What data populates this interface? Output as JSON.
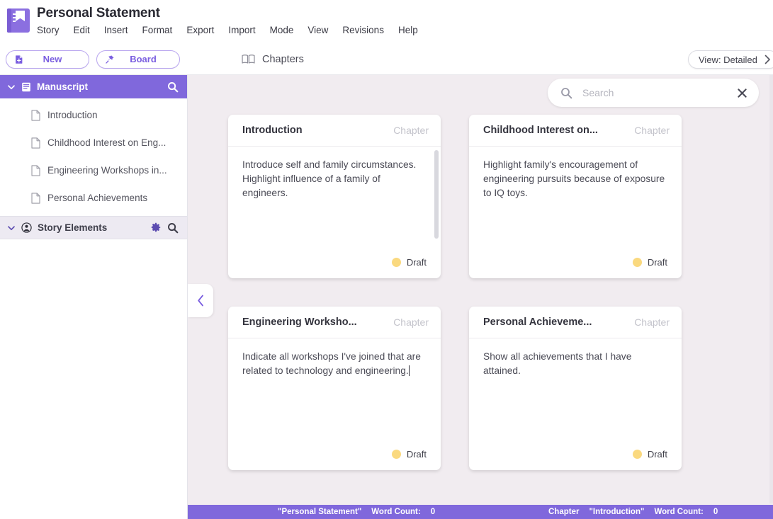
{
  "app": {
    "title": "Personal Statement",
    "logo_icon": "book-journal-icon"
  },
  "menubar": {
    "items": [
      {
        "label": "Story"
      },
      {
        "label": "Edit"
      },
      {
        "label": "Insert"
      },
      {
        "label": "Format"
      },
      {
        "label": "Export"
      },
      {
        "label": "Import"
      },
      {
        "label": "Mode"
      },
      {
        "label": "View"
      },
      {
        "label": "Revisions"
      },
      {
        "label": "Help"
      }
    ]
  },
  "toolbar": {
    "new_label": "New",
    "new_icon": "new-document-icon",
    "board_label": "Board",
    "board_icon": "pin-icon"
  },
  "content_header": {
    "title": "Chapters",
    "icon": "open-book-icon",
    "view_toggle_label": "View: Detailed",
    "view_toggle_icon": "chevron-right-icon"
  },
  "sidebar": {
    "manuscript": {
      "label": "Manuscript",
      "collapse_icon": "chevron-down-icon",
      "section_icon": "manuscript-icon",
      "search_icon": "search-icon",
      "documents": [
        {
          "label": "Introduction",
          "icon": "document-icon"
        },
        {
          "label": "Childhood Interest on Eng...",
          "icon": "document-icon"
        },
        {
          "label": "Engineering Workshops in...",
          "icon": "document-icon"
        },
        {
          "label": "Personal Achievements",
          "icon": "document-icon"
        }
      ]
    },
    "story_elements": {
      "label": "Story Elements",
      "collapse_icon": "chevron-down-icon",
      "section_icon": "character-circle-icon",
      "settings_icon": "gear-icon",
      "search_icon": "search-icon"
    }
  },
  "search": {
    "value": "",
    "placeholder": "Search",
    "icon": "search-icon",
    "clear_icon": "close-icon"
  },
  "board": {
    "collapse_handle_icon": "chevron-left-icon",
    "cards": [
      {
        "title": "Introduction",
        "kind": "Chapter",
        "synopsis": "Introduce self and family circumstances. Highlight influence of a family of engineers.",
        "status": "Draft",
        "status_color": "#fad97f",
        "has_scrollbar": true,
        "has_caret": false
      },
      {
        "title": "Childhood Interest on...",
        "kind": "Chapter",
        "synopsis": "Highlight family's encouragement of engineering pursuits because of exposure to IQ toys.",
        "status": "Draft",
        "status_color": "#fad97f",
        "has_scrollbar": false,
        "has_caret": false
      },
      {
        "title": "Engineering Worksho...",
        "kind": "Chapter",
        "synopsis": "Indicate all workshops I've joined that are related to technology and engineering.",
        "status": "Draft",
        "status_color": "#fad97f",
        "has_scrollbar": false,
        "has_caret": true
      },
      {
        "title": "Personal Achieveme...",
        "kind": "Chapter",
        "synopsis": "Show all achievements that I have attained.",
        "status": "Draft",
        "status_color": "#fad97f",
        "has_scrollbar": false,
        "has_caret": false
      }
    ]
  },
  "statusbar": {
    "project_name": "\"Personal Statement\"",
    "project_wordcount_label": "Word Count:",
    "project_wordcount_value": "0",
    "chapter_label": "Chapter",
    "chapter_name": "\"Introduction\"",
    "chapter_wordcount_label": "Word Count:",
    "chapter_wordcount_value": "0"
  },
  "colors": {
    "accent_purple": "#8068dc",
    "board_background": "#f1ecf0",
    "status_draft": "#fad97f"
  }
}
